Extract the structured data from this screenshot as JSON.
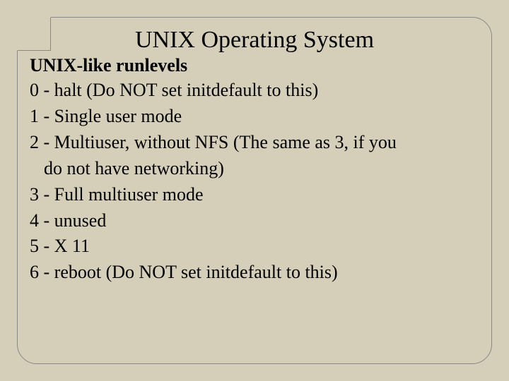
{
  "slide": {
    "title": "UNIX Operating System",
    "subtitle": "UNIX-like runlevels",
    "lines": {
      "l0": "0 - halt (Do NOT set initdefault to this)",
      "l1": "1 - Single user mode",
      "l2a": "2 - Multiuser, without NFS (The same as 3, if you",
      "l2b": "do  not have networking)",
      "l3": "3 - Full multiuser mode",
      "l4": "4 - unused",
      "l5": "5 - X 11",
      "l6": "6 - reboot (Do NOT set initdefault to this)"
    }
  }
}
